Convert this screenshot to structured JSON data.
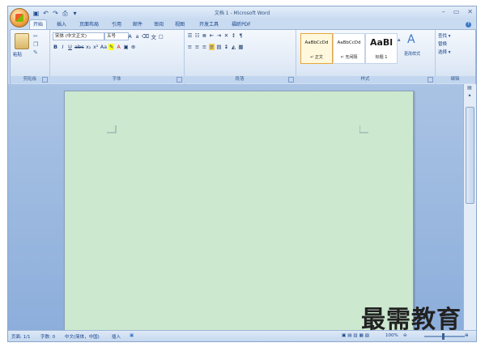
{
  "app": {
    "title": "文档 1 - Microsoft Word"
  },
  "qat": {
    "save_icon": "floppy-icon",
    "undo_icon": "undo-icon",
    "redo_icon": "redo-icon",
    "customize": "▾"
  },
  "window_controls": {
    "minimize": "–",
    "restore": "▭",
    "close": "✕"
  },
  "tabs": [
    {
      "label": "开始",
      "active": true
    },
    {
      "label": "插入"
    },
    {
      "label": "页面布局"
    },
    {
      "label": "引用"
    },
    {
      "label": "邮件"
    },
    {
      "label": "审阅"
    },
    {
      "label": "视图"
    },
    {
      "label": "开发工具"
    },
    {
      "label": "福昕PDF"
    }
  ],
  "ribbon": {
    "clipboard": {
      "paste_label": "粘贴",
      "group_label": "剪贴板"
    },
    "font": {
      "font_name": "宋体 (中文正文)",
      "font_size": "五号",
      "group_label": "字体",
      "row2_buttons": [
        "B",
        "I",
        "U",
        "abc",
        "x₂",
        "x²",
        "Aa"
      ]
    },
    "paragraph": {
      "group_label": "段落"
    },
    "styles": {
      "group_label": "样式",
      "tiles": [
        {
          "sample": "AaBbCcDd",
          "name": "↵ 正文",
          "selected": true
        },
        {
          "sample": "AaBbCcDd",
          "name": "↵ 无间隔"
        },
        {
          "sample": "AaBl",
          "name": "标题 1"
        }
      ],
      "change_styles_label": "更改样式"
    },
    "editing": {
      "group_label": "编辑",
      "find_label": "查找 ▾",
      "replace_label": "替换",
      "select_label": "选择 ▾"
    }
  },
  "statusbar": {
    "page": "页面: 1/1",
    "words": "字数: 0",
    "language": "中文(简体，中国)",
    "mode": "插入",
    "zoom": "100%"
  },
  "watermark": "最需教育",
  "colors": {
    "page_bg": "#cce8cf",
    "ribbon_bg": "#dfe9f6",
    "doc_bg": "#8daedb"
  }
}
